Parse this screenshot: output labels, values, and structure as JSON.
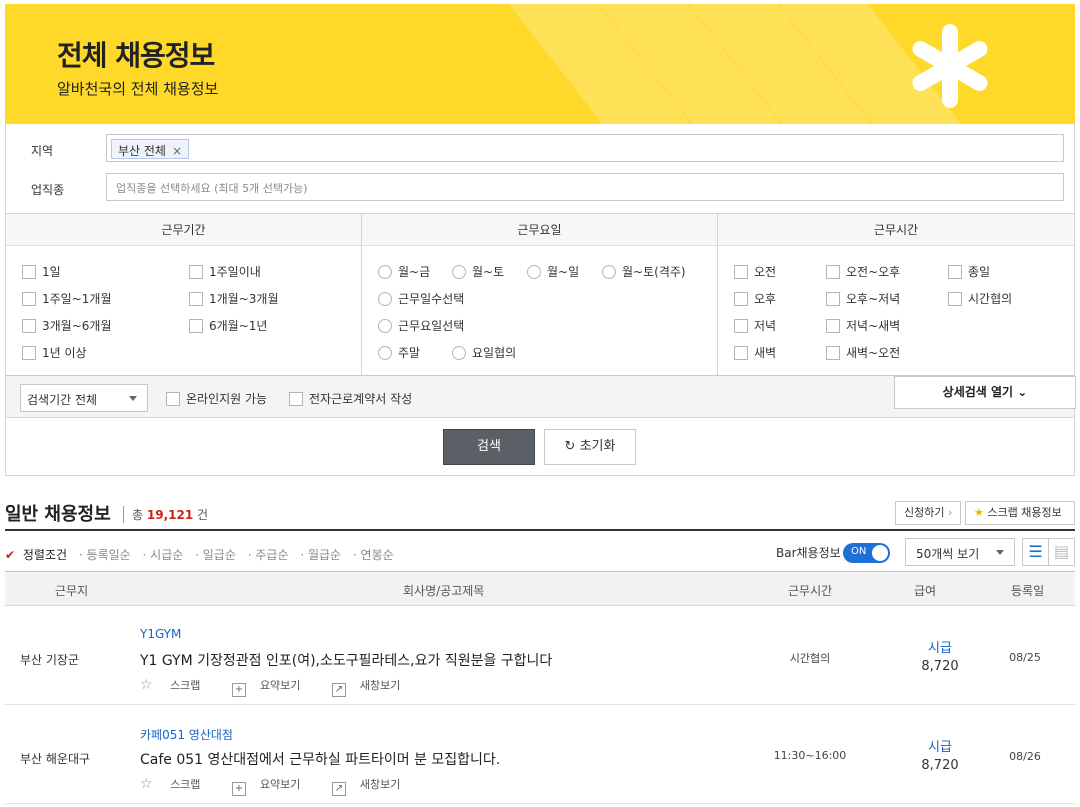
{
  "banner": {
    "title": "전체 채용정보",
    "subtitle": "알바천국의 전체 채용정보"
  },
  "filters": {
    "region_label": "지역",
    "region_chip": "부산 전체",
    "job_label": "업직종",
    "job_placeholder": "업직종을 선택하세요 (최대 5개 선택가능)",
    "period": {
      "head": "근무기간",
      "options": [
        "1일",
        "1주일이내",
        "1주일~1개월",
        "1개월~3개월",
        "3개월~6개월",
        "6개월~1년",
        "1년 이상"
      ]
    },
    "days": {
      "head": "근무요일",
      "options": [
        "월~금",
        "월~토",
        "월~일",
        "월~토(격주)",
        "근무일수선택",
        "근무요일선택",
        "주말",
        "요일협의"
      ]
    },
    "time": {
      "head": "근무시간",
      "options": [
        "오전",
        "오전~오후",
        "종일",
        "오후",
        "오후~저녁",
        "시간협의",
        "저녁",
        "저녁~새벽",
        "새벽",
        "새벽~오전"
      ]
    },
    "search_period": "검색기간 전체",
    "online_apply": "온라인지원 가능",
    "e_contract": "전자근로계약서 작성",
    "advanced": "상세검색 열기",
    "search_btn": "검색",
    "reset_btn": "초기화"
  },
  "list": {
    "title": "일반 채용정보",
    "total_prefix": "총",
    "total": "19,121",
    "total_suffix": "건",
    "apply_btn": "신청하기",
    "scrap_btn": "스크랩 채용정보",
    "sorts": [
      "정렬조건",
      "등록일순",
      "시급순",
      "일급순",
      "주급순",
      "월급순",
      "연봉순"
    ],
    "bar_label": "Bar채용정보",
    "toggle": "ON",
    "per_page": "50개씩 보기",
    "columns": [
      "근무지",
      "회사명/공고제목",
      "근무시간",
      "급여",
      "등록일"
    ],
    "rows": [
      {
        "loc": "부산 기장군",
        "company": "Y1GYM",
        "title": "Y1 GYM 기장정관점 인포(여),소도구필라테스,요가 직원분을 구합니다",
        "scrap": "스크랩",
        "summary": "요약보기",
        "newwin": "새창보기",
        "hours": "시간협의",
        "pay_type": "시급",
        "pay": "8,720",
        "date": "08/25"
      },
      {
        "loc": "부산 해운대구",
        "company": "카페051 영산대점",
        "title": "Cafe 051 영산대점에서 근무하실 파트타이머 분 모집합니다.",
        "scrap": "스크랩",
        "summary": "요약보기",
        "newwin": "새창보기",
        "hours": "11:30~16:00",
        "pay_type": "시급",
        "pay": "8,720",
        "date": "08/26"
      }
    ]
  }
}
